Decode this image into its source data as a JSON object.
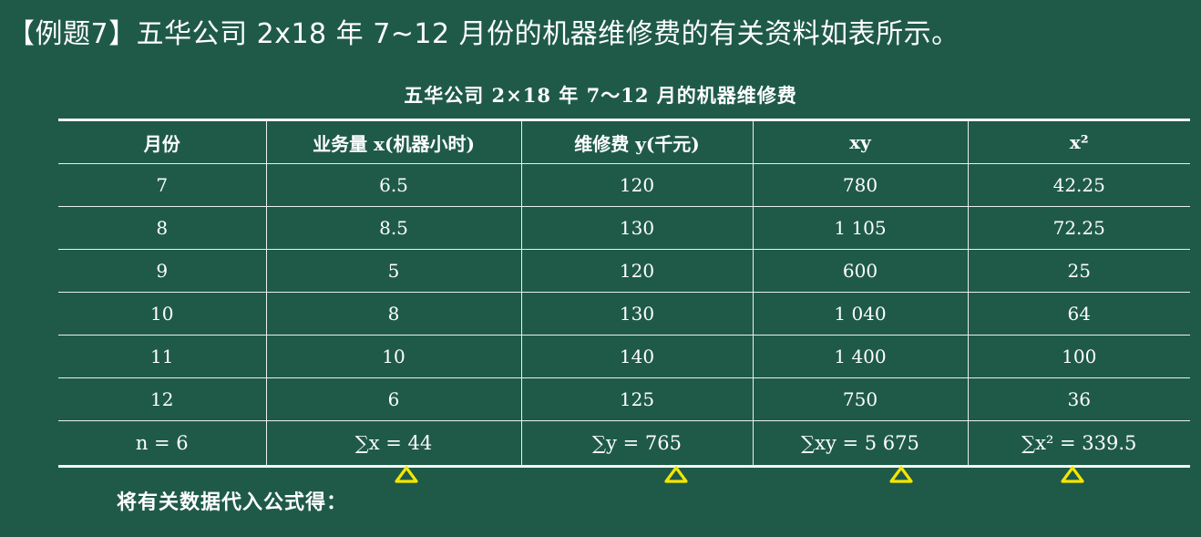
{
  "heading": "【例题7】五华公司 2x18 年 7~12 月份的机器维修费的有关资料如表所示。",
  "table_title": "五华公司 2×18 年 7～12 月的机器维修费",
  "table": {
    "headers": [
      "月份",
      "业务量 x(机器小时)",
      "维修费 y(千元)",
      "xy",
      "x²"
    ],
    "rows": [
      [
        "7",
        "6.5",
        "120",
        "780",
        "42.25"
      ],
      [
        "8",
        "8.5",
        "130",
        "1 105",
        "72.25"
      ],
      [
        "9",
        "5",
        "120",
        "600",
        "25"
      ],
      [
        "10",
        "8",
        "130",
        "1 040",
        "64"
      ],
      [
        "11",
        "10",
        "140",
        "1 400",
        "100"
      ],
      [
        "12",
        "6",
        "125",
        "750",
        "36"
      ]
    ],
    "summary": [
      "n = 6",
      "∑x = 44",
      "∑y = 765",
      "∑xy = 5 675",
      "∑x² = 339.5"
    ]
  },
  "annotation_color": "#f5e600",
  "annotation_icon": "triangle-mark-icon",
  "footer_text": "将有关数据代入公式得："
}
